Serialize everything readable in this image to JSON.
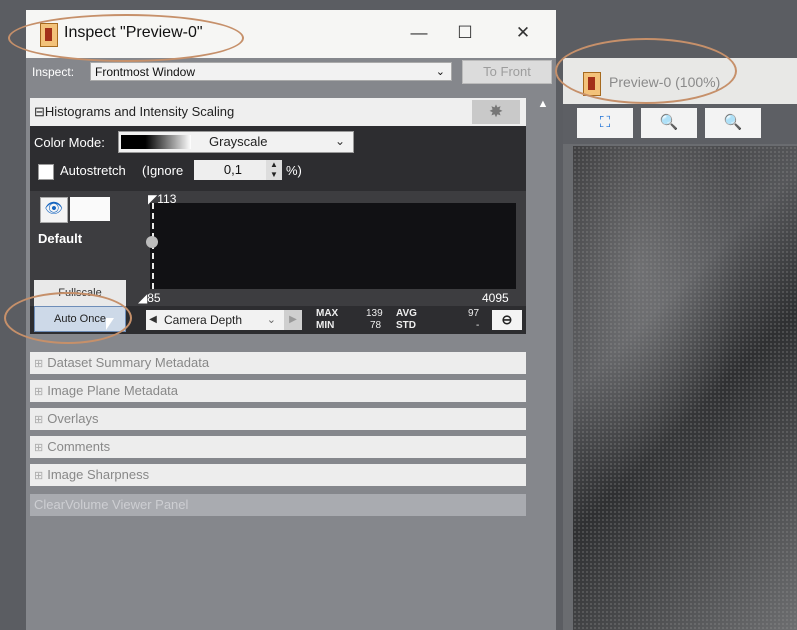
{
  "inspect_window": {
    "title": "Inspect \"Preview-0\"",
    "controls": {
      "minimize": "—",
      "maximize": "☐",
      "close": "✕"
    },
    "inspect_label": "Inspect:",
    "inspect_target": "Frontmost Window",
    "to_front_label": "To Front"
  },
  "histogram_panel": {
    "header": "Histograms and Intensity Scaling",
    "collapse_glyph": "⊟",
    "gear_glyph": "✸",
    "color_mode_label": "Color Mode:",
    "color_mode_value": "Grayscale",
    "autostretch_label": "Autostretch",
    "ignore_label": "(Ignore",
    "ignore_value": "0,1",
    "percent_label": "%)",
    "channel_name": "Default",
    "max_marker": "113",
    "min_marker": "85",
    "range_max": "4095",
    "fullscale_label": "Fullscale",
    "auto_once_label": "Auto Once",
    "camera_depth_label": "Camera Depth",
    "stats": {
      "max_label": "MAX",
      "max_value": "139",
      "min_label": "MIN",
      "min_value": "78",
      "avg_label": "AVG",
      "avg_value": "97",
      "std_label": "STD",
      "std_value": "-"
    },
    "link_glyph": "⊖"
  },
  "sections": [
    "Dataset Summary Metadata",
    "Image Plane Metadata",
    "Overlays",
    "Comments",
    "Image Sharpness"
  ],
  "clearvolume_label": "ClearVolume Viewer Panel",
  "preview_window": {
    "title": "Preview-0 (100%)",
    "tools": [
      "⛶",
      "🔍",
      "🔍"
    ]
  },
  "colors": {
    "panel_dark": "#2d2d30",
    "section_bg": "#ededed",
    "auto_once_bg": "#cdd9e8",
    "annotation": "#c6906a"
  }
}
